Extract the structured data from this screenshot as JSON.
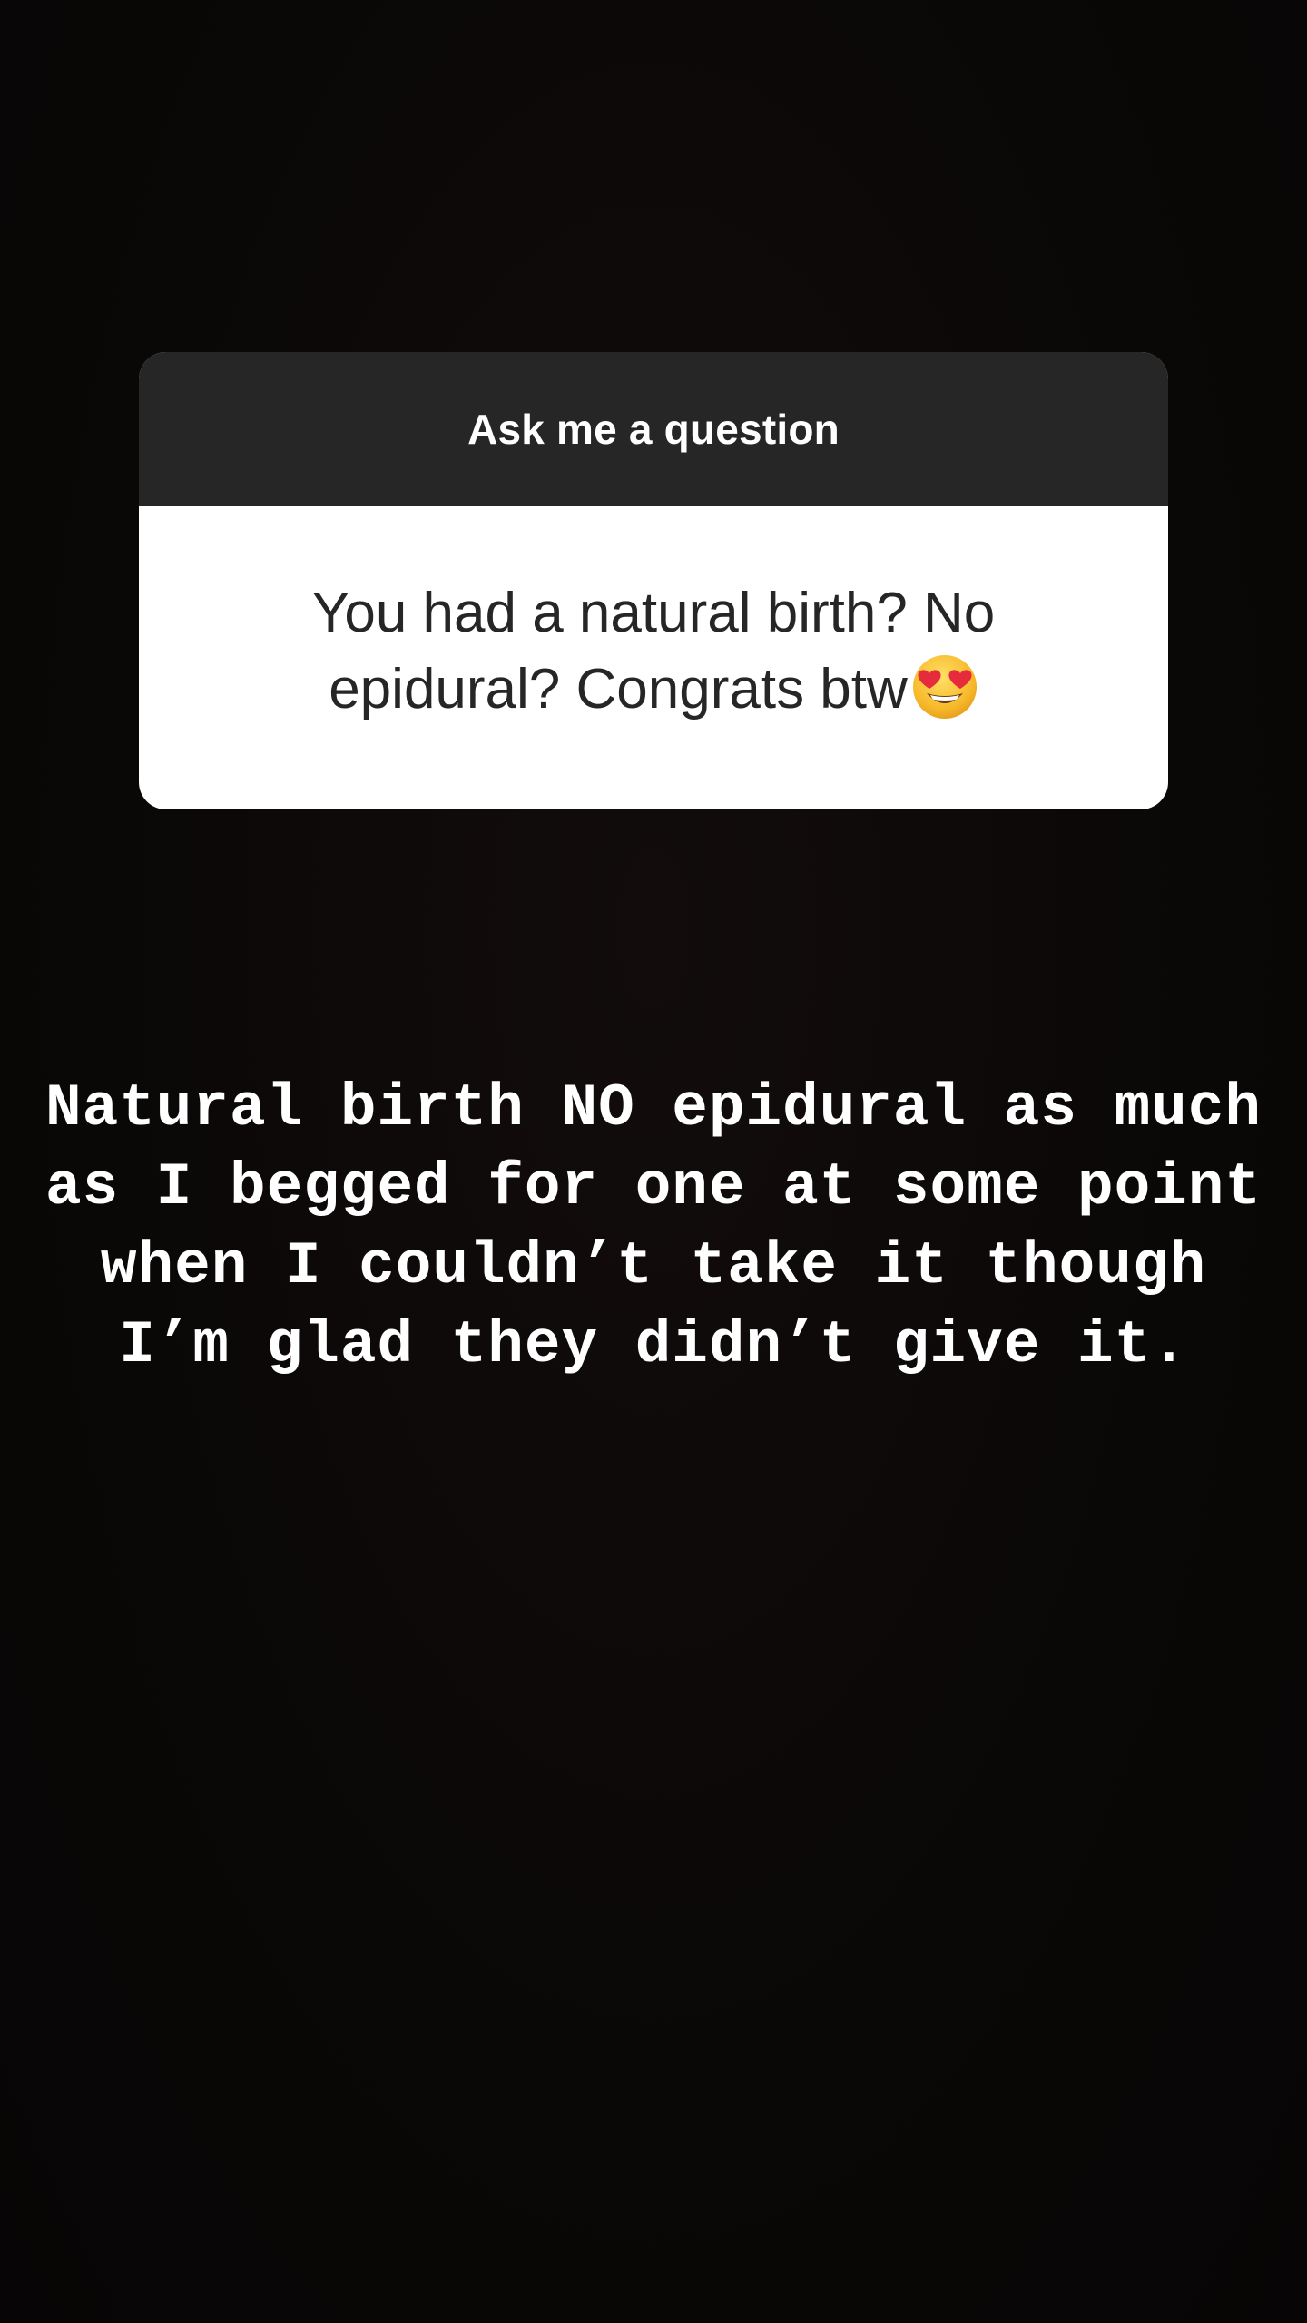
{
  "question_sticker": {
    "header": "Ask me a question",
    "question": "You had a natural birth? No epidural? Congrats btw",
    "emoji_icon": "heart-eyes-emoji"
  },
  "answer": {
    "text": "Natural birth NO epidural as much as I begged for one at some point when I couldn’t take it though I’m glad they didn’t give it."
  },
  "colors": {
    "background": "#0b0808",
    "sticker_header": "#262626",
    "sticker_body": "#ffffff",
    "question_text": "#262626",
    "answer_text": "#ffffff"
  }
}
